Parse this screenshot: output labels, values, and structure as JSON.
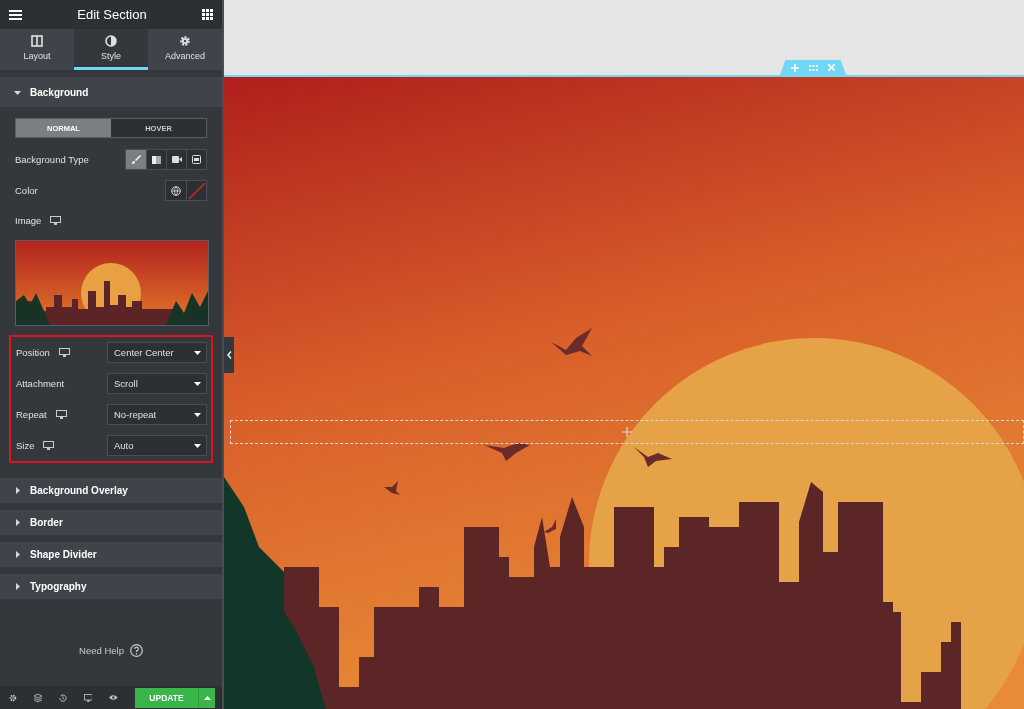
{
  "panel": {
    "title": "Edit Section"
  },
  "tabs": [
    {
      "label": "Layout",
      "kind": "columns",
      "selected": false
    },
    {
      "label": "Style",
      "kind": "contrast",
      "selected": true
    },
    {
      "label": "Advanced",
      "kind": "gear",
      "selected": false
    }
  ],
  "sections": [
    {
      "title": "Background",
      "expanded": true
    },
    {
      "title": "Background Overlay",
      "expanded": false
    },
    {
      "title": "Border",
      "expanded": false
    },
    {
      "title": "Shape Divider",
      "expanded": false
    },
    {
      "title": "Typography",
      "expanded": false
    }
  ],
  "state_toggle": [
    {
      "label": "NORMAL",
      "selected": true
    },
    {
      "label": "HOVER",
      "selected": false
    }
  ],
  "background_type": {
    "label": "Background Type",
    "options": [
      {
        "kind": "brush",
        "selected": true
      },
      {
        "kind": "gradient",
        "selected": false
      },
      {
        "kind": "video",
        "selected": false
      },
      {
        "kind": "slideshow",
        "selected": false
      }
    ]
  },
  "color": {
    "label": "Color"
  },
  "image": {
    "label": "Image",
    "responsive": true
  },
  "selects": [
    {
      "label": "Position",
      "responsive": true,
      "value": "Center Center"
    },
    {
      "label": "Attachment",
      "responsive": false,
      "value": "Scroll"
    },
    {
      "label": "Repeat",
      "responsive": true,
      "value": "No-repeat"
    },
    {
      "label": "Size",
      "responsive": true,
      "value": "Auto"
    }
  ],
  "help": {
    "label": "Need Help"
  },
  "footer": {
    "update": "UPDATE"
  }
}
